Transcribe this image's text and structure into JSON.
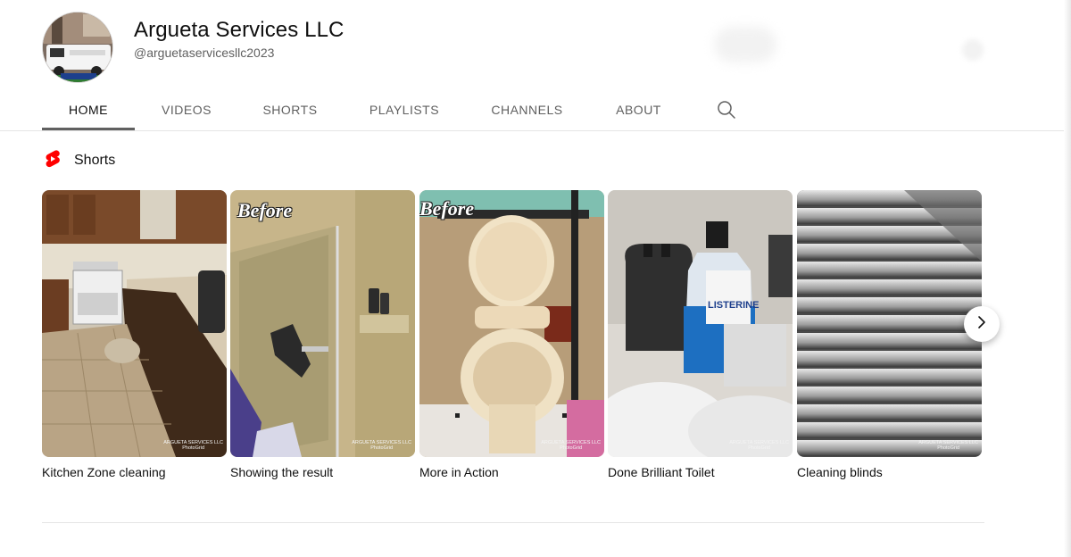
{
  "channel": {
    "name": "Argueta Services LLC",
    "handle": "@arguetaservicesllc2023"
  },
  "tabs": [
    {
      "label": "HOME",
      "active": true
    },
    {
      "label": "VIDEOS",
      "active": false
    },
    {
      "label": "SHORTS",
      "active": false
    },
    {
      "label": "PLAYLISTS",
      "active": false
    },
    {
      "label": "CHANNELS",
      "active": false
    },
    {
      "label": "ABOUT",
      "active": false
    }
  ],
  "shorts": {
    "section_title": "Shorts",
    "items": [
      {
        "title": "Kitchen Zone cleaning",
        "overlay": ""
      },
      {
        "title": "Showing the result",
        "overlay": "Before"
      },
      {
        "title": "More in Action",
        "overlay": "Before"
      },
      {
        "title": "Done Brilliant Toilet",
        "overlay": ""
      },
      {
        "title": "Cleaning blinds",
        "overlay": ""
      }
    ]
  },
  "watermark": {
    "line1": "ARGUETA SERVICES LLC",
    "line2": "PhotoGrid"
  },
  "colors": {
    "shorts_red": "#ff0000",
    "active_underline": "#606060",
    "tab_text": "#606060"
  },
  "icons": {
    "search": "search-icon",
    "shorts": "shorts-logo-icon",
    "next": "chevron-right-icon"
  }
}
